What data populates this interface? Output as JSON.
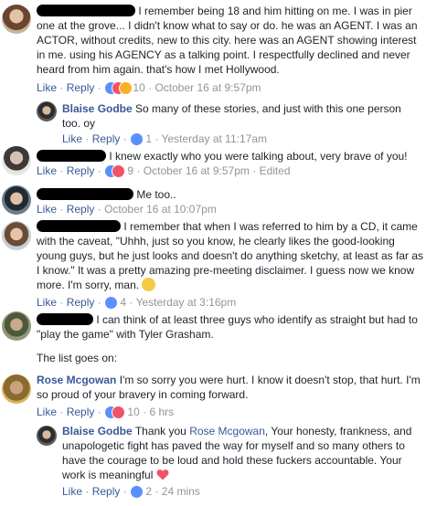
{
  "actions": {
    "like": "Like",
    "reply": "Reply",
    "sep": "·"
  },
  "comments": [
    {
      "text": "I remember being 18 and him hitting on me. I was in pier one at the grove... I didn't know what to say or do. he was an AGENT. I was an ACTOR, without credits, new to this city. here was an AGENT showing interest in me. using his AGENCY as a talking point. I respectfully declined and never heard from him again. that's how I met Hollywood.",
      "reaction_count": "10",
      "time": "October 16 at 9:57pm"
    },
    {
      "name": "Blaise Godbe",
      "text": "So many of these stories, and just with this one person too. oy",
      "reaction_count": "1",
      "time": "Yesterday at 11:17am"
    },
    {
      "text": "I knew exactly who you were talking about, very brave of you!",
      "reaction_count": "9",
      "time": "October 16 at 9:57pm",
      "edited": "Edited"
    },
    {
      "text": "Me too..",
      "time": "October 16 at 10:07pm"
    },
    {
      "text": "I remember that when I was referred to him by a CD, it came with the caveat, \"Uhhh, just so you know, he clearly likes the good-looking young guys, but he just looks and doesn't do anything sketchy, at least as far as I know.\" It was a pretty amazing pre-meeting disclaimer. I guess now we know more. I'm sorry, man.",
      "reaction_count": "4",
      "time": "Yesterday at 3:16pm"
    },
    {
      "text": "I can think of at least three guys who identify as straight but had to \"play the game\" with Tyler Grasham.",
      "followup": "The list goes on:"
    },
    {
      "name": "Rose Mcgowan",
      "text": "I'm so sorry you were hurt. I know it doesn't stop, that hurt. I'm so proud of your bravery in coming forward.",
      "reaction_count": "10",
      "time": "6 hrs"
    },
    {
      "name": "Blaise Godbe",
      "text_before": "Thank you",
      "mention": "Rose Mcgowan",
      "text_after": ", Your honesty, frankness, and unapologetic fight has paved the way for myself and so many others to have the courage to be loud and hold these fuckers accountable. Your work is meaningful",
      "reaction_count": "2",
      "time": "24 mins"
    }
  ],
  "colors": {
    "link": "#385898",
    "meta": "#90949c",
    "like": "#5890ff",
    "love": "#f25268"
  }
}
